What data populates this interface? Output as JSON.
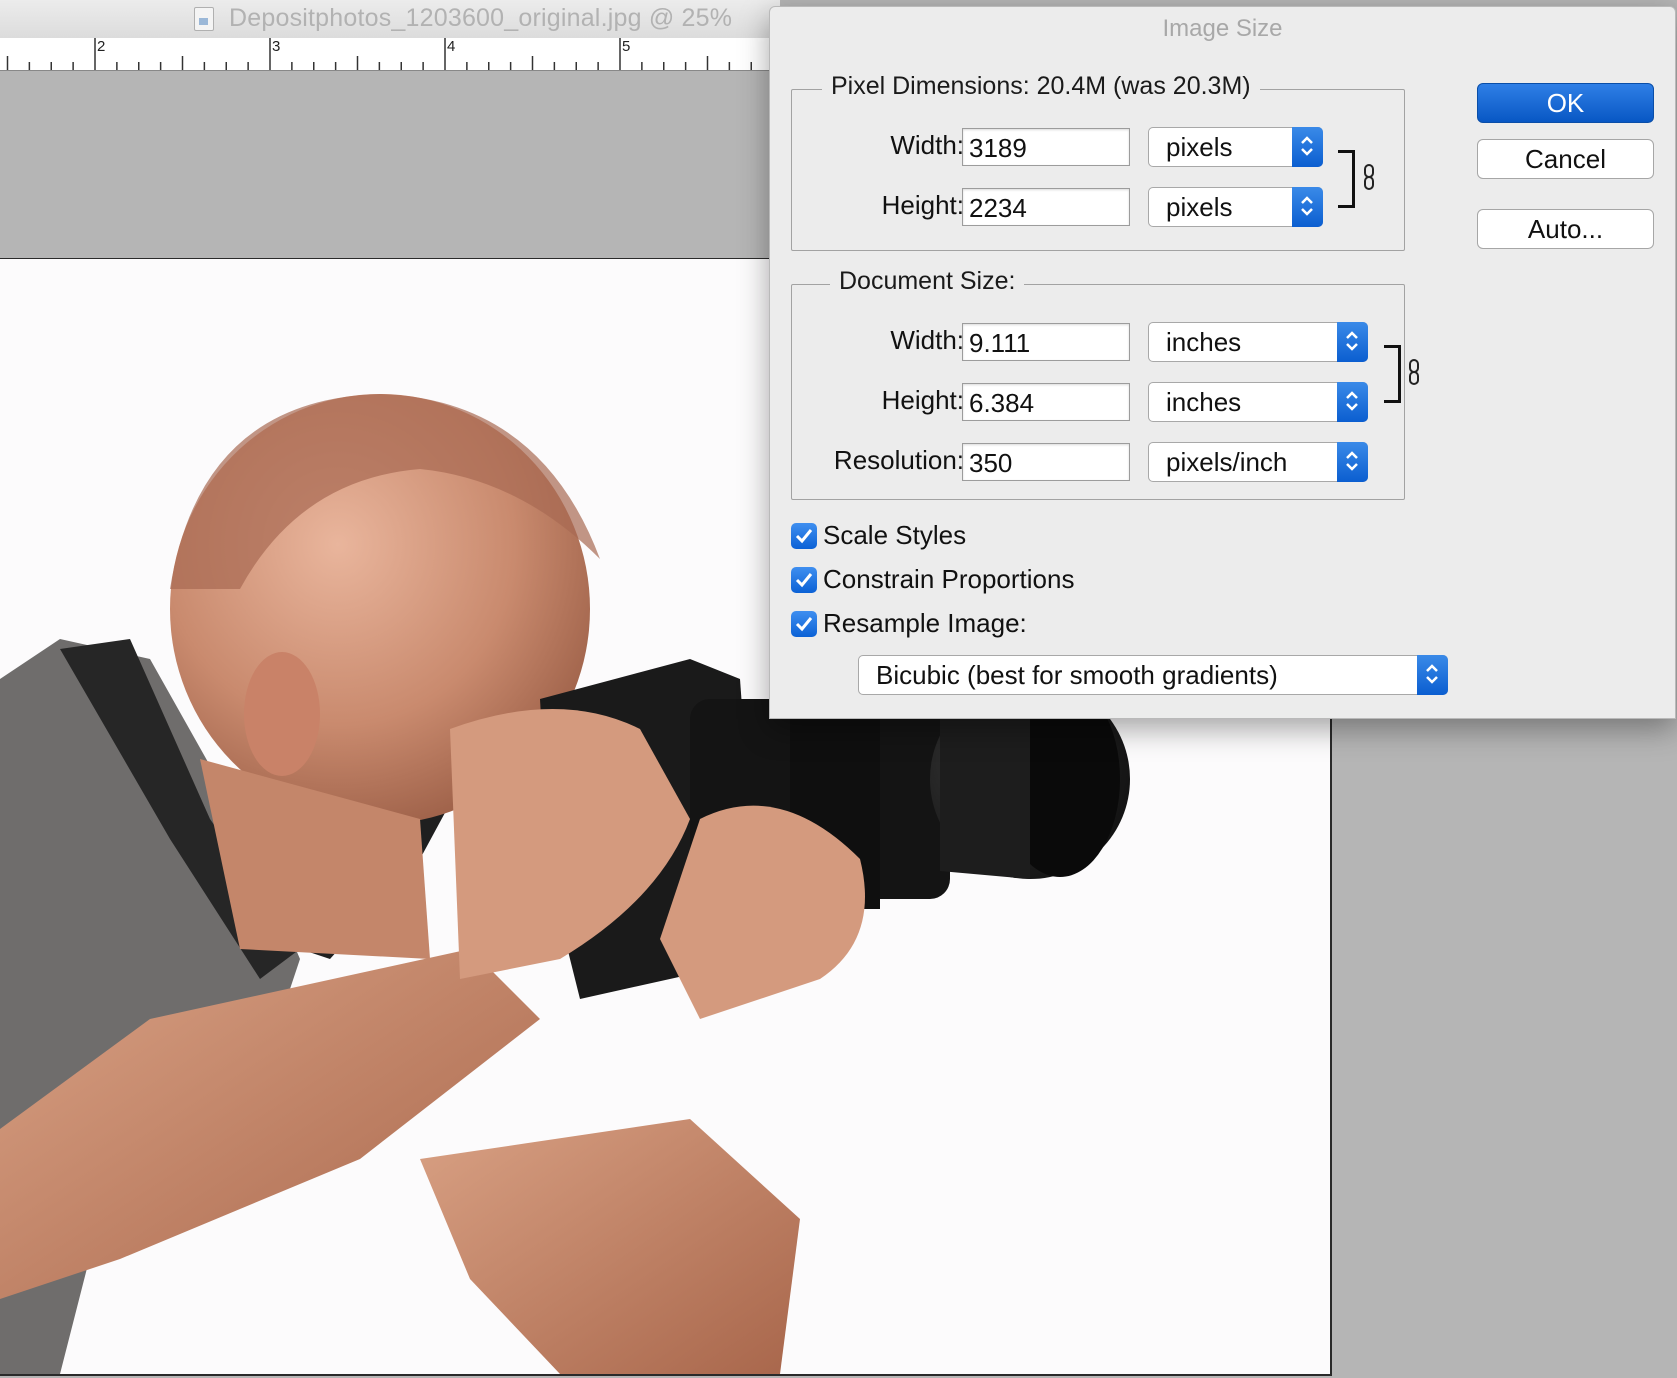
{
  "document": {
    "title": "Depositphotos_1203600_original.jpg @ 25%",
    "ruler_labels": [
      "2",
      "3",
      "4",
      "5"
    ]
  },
  "dialog": {
    "title": "Image Size",
    "pixel_dimensions": {
      "legend": "Pixel Dimensions:  20.4M (was 20.3M)",
      "width_label": "Width:",
      "width_value": "3189",
      "width_unit": "pixels",
      "height_label": "Height:",
      "height_value": "2234",
      "height_unit": "pixels"
    },
    "document_size": {
      "legend": "Document Size:",
      "width_label": "Width:",
      "width_value": "9.111",
      "width_unit": "inches",
      "height_label": "Height:",
      "height_value": "6.384",
      "height_unit": "inches",
      "resolution_label": "Resolution:",
      "resolution_value": "350",
      "resolution_unit": "pixels/inch"
    },
    "options": {
      "scale_styles": "Scale Styles",
      "constrain_proportions": "Constrain Proportions",
      "resample_image": "Resample Image:",
      "resample_method": "Bicubic (best for smooth gradients)"
    },
    "buttons": {
      "ok": "OK",
      "cancel": "Cancel",
      "auto": "Auto..."
    }
  }
}
